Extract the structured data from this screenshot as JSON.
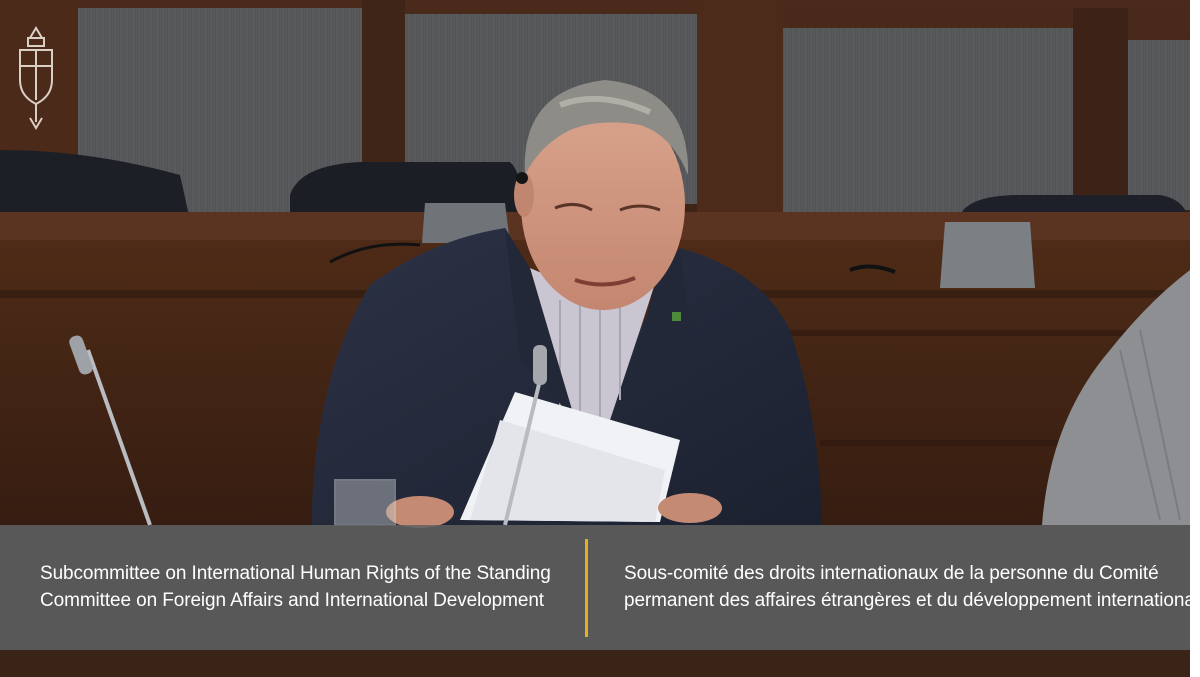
{
  "caption": {
    "english_lines": [
      "Subcommittee on International Human Rights of the Standing",
      "Committee on Foreign Affairs and International Development"
    ],
    "french_lines": [
      "Sous-comité des droits internationaux de la personne du Comité",
      "permanent des affaires étrangères et du développement international"
    ]
  },
  "colors": {
    "caption_background": "#5f6264",
    "caption_divider": "#e3b21b",
    "caption_text": "#ffffff"
  },
  "icons": {
    "crest": "house-of-commons-crest-icon"
  }
}
